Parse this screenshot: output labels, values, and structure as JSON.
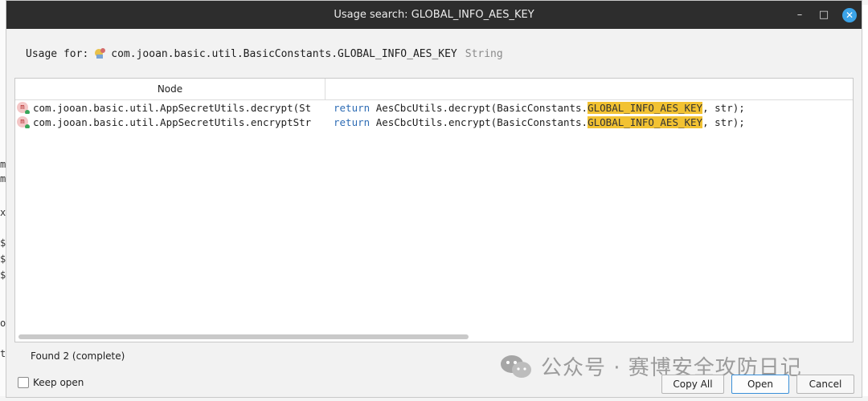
{
  "window": {
    "title": "Usage search: GLOBAL_INFO_AES_KEY",
    "controls": {
      "minimize": "–",
      "maximize": "□",
      "close": "✕"
    }
  },
  "usage": {
    "label": "Usage for:",
    "target": "com.jooan.basic.util.BasicConstants.GLOBAL_INFO_AES_KEY",
    "type": "String",
    "icon": "constant-field-icon"
  },
  "table": {
    "columns": [
      "Node",
      ""
    ],
    "rows": [
      {
        "node": "com.jooan.basic.util.AppSecretUtils.decrypt(St",
        "kw": "return",
        "code_before": "AesCbcUtils.decrypt(BasicConstants.",
        "match": "GLOBAL_INFO_AES_KEY",
        "code_after": ", str);",
        "icon": "method-icon"
      },
      {
        "node": "com.jooan.basic.util.AppSecretUtils.encryptStr",
        "kw": "return",
        "code_before": "AesCbcUtils.encrypt(BasicConstants.",
        "match": "GLOBAL_INFO_AES_KEY",
        "code_after": ", str);",
        "icon": "method-icon"
      }
    ]
  },
  "status": {
    "found": "Found 2 (complete)"
  },
  "options": {
    "keep_open": "Keep open"
  },
  "buttons": {
    "copy_all": "Copy All",
    "open": "Open",
    "cancel": "Cancel"
  },
  "watermark": {
    "text": "公众号 · 赛博安全攻防日记",
    "icon": "wechat-icon"
  },
  "background_glyphs": [
    "m",
    "m",
    "x",
    "$",
    "$",
    "$",
    "o",
    "t"
  ],
  "colors": {
    "highlight": "#f2c232",
    "keyword": "#2f6db5",
    "titlebar": "#2d2d2d",
    "accent": "#3ba3e8"
  }
}
